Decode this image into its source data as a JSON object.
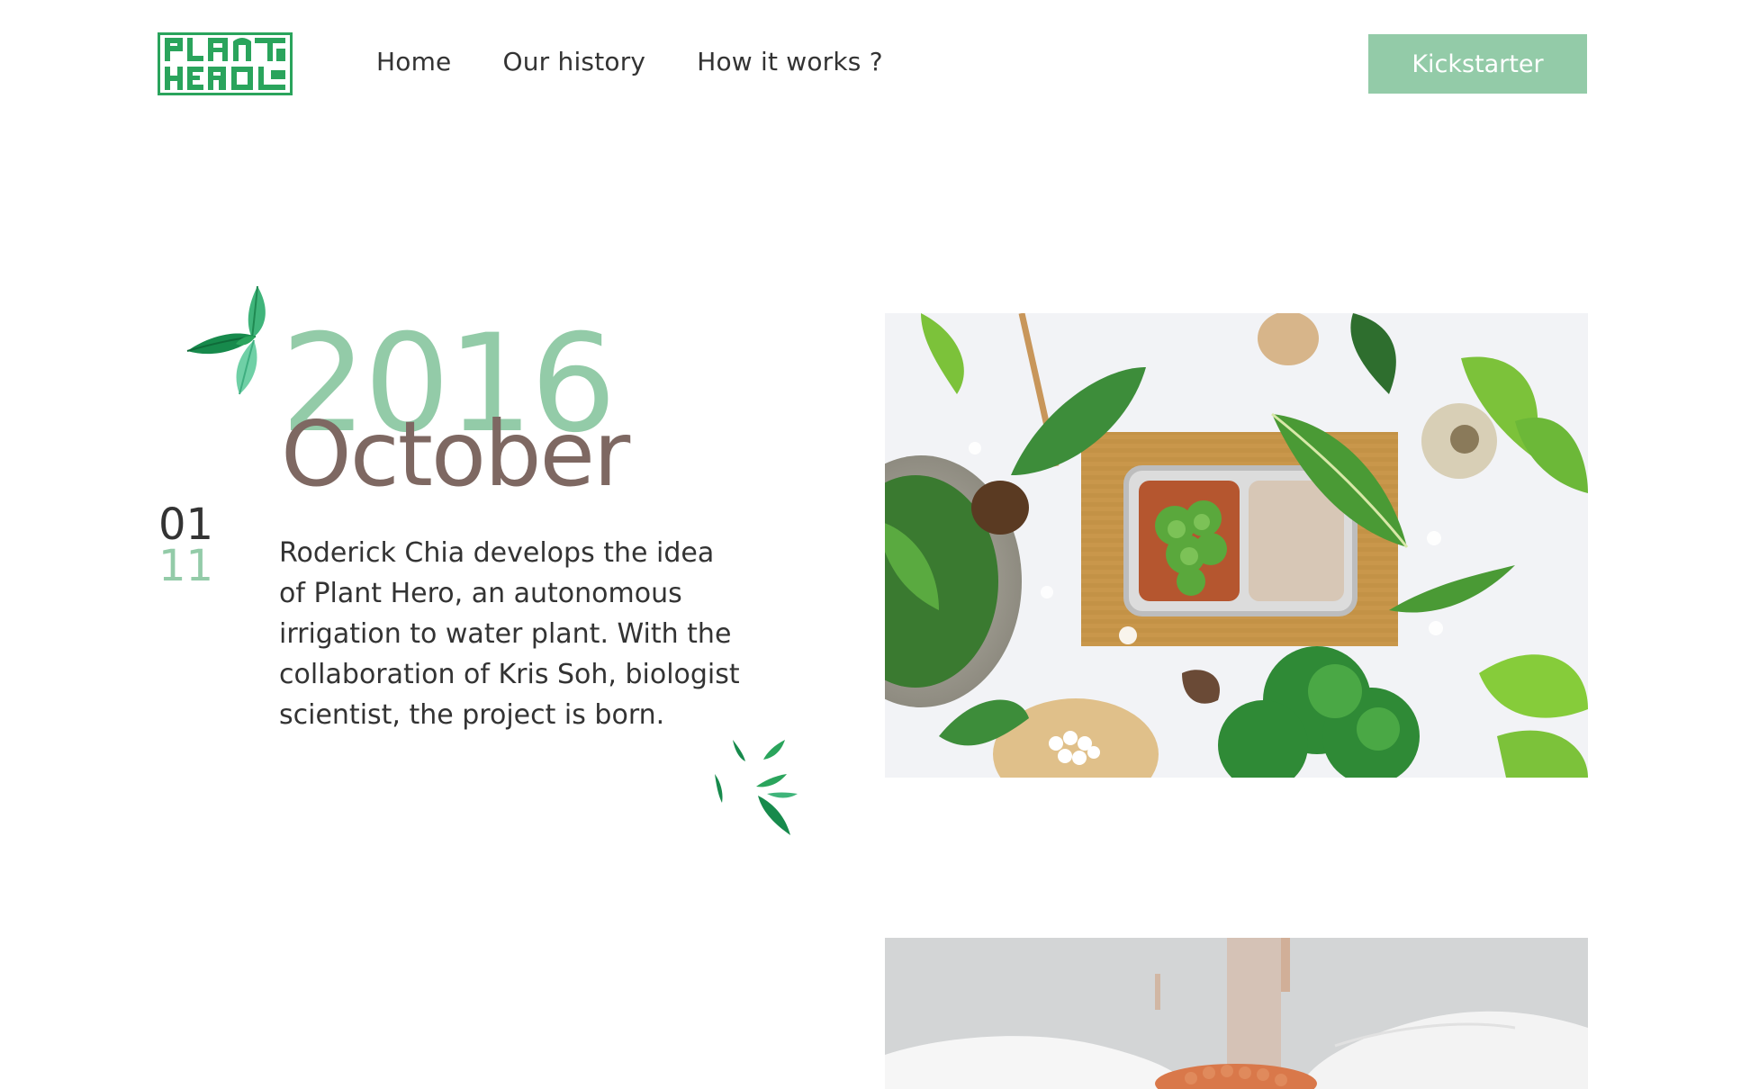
{
  "brand": {
    "logo_alt": "Plant Hero",
    "logo_lines": [
      "PLANT",
      "HERO"
    ],
    "accent_color": "#93cba8",
    "logo_color": "#2aa45c",
    "month_color": "#7e6862"
  },
  "nav": {
    "items": [
      {
        "label": "Home"
      },
      {
        "label": "Our history"
      },
      {
        "label": "How it works ?"
      }
    ],
    "cta_label": "Kickstarter"
  },
  "timeline": {
    "entry": {
      "year": "2016",
      "month": "October",
      "day": "01",
      "month_number": "11",
      "description": "Roderick Chia develops the idea of Plant Hero, an autonomous irrigation to water plant. With the collaboration of Kris Soh, biologist scientist, the project is born."
    }
  },
  "icons": {
    "leaf_top": "leaf-cluster-icon",
    "leaf_bottom": "leaf-sprig-icon"
  }
}
